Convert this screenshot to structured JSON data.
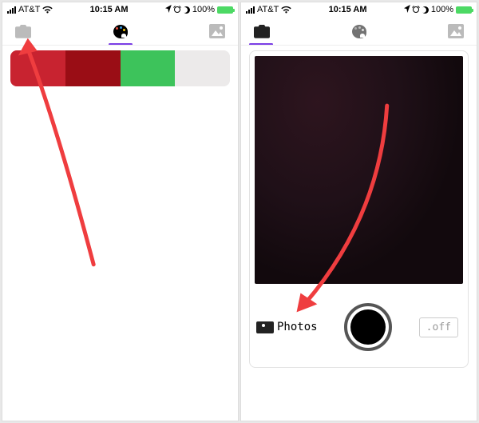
{
  "statusbar": {
    "carrier": "AT&T",
    "time": "10:15 AM",
    "battery_pct": "100%"
  },
  "left": {
    "tabs": {
      "camera": "camera",
      "palette": "palette",
      "gallery": "gallery",
      "active": "palette"
    },
    "swatches": [
      {
        "color": "#c82330"
      },
      {
        "color": "#9a0d15"
      },
      {
        "color": "#3dc35b"
      },
      {
        "color": "#eceaea"
      }
    ]
  },
  "right": {
    "tabs": {
      "camera": "camera",
      "palette": "palette",
      "gallery": "gallery",
      "active": "camera"
    },
    "controls": {
      "photos_label": "Photos",
      "flash_label": ".off"
    }
  },
  "annotation_color": "#ef3d3f"
}
